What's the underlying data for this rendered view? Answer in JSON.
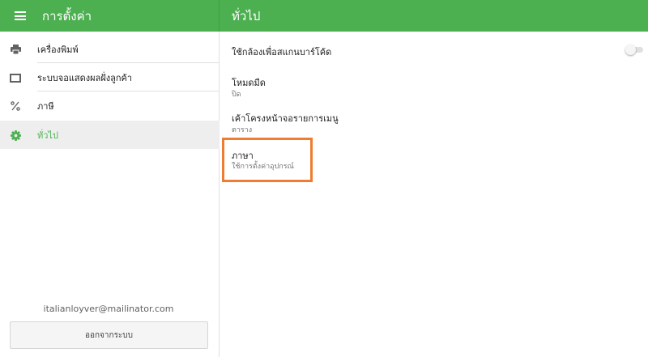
{
  "header": {
    "title": "การตั้งค่า",
    "section_title": "ทั่วไป"
  },
  "sidebar": {
    "items": [
      {
        "label": "เครื่องพิมพ์",
        "icon": "printer-icon"
      },
      {
        "label": "ระบบจอแสดงผลฝั่งลูกค้า",
        "icon": "display-icon"
      },
      {
        "label": "ภาษี",
        "icon": "percent-icon"
      },
      {
        "label": "ทั่วไป",
        "icon": "gear-icon",
        "active": true
      }
    ],
    "email": "italianloyver@mailinator.com",
    "logout_label": "ออกจากระบบ"
  },
  "settings": {
    "camera_scan": {
      "title": "ใช้กล้องเพื่อสแกนบาร์โค้ด",
      "enabled": false
    },
    "dark_mode": {
      "title": "โหมดมืด",
      "value": "ปิด"
    },
    "menu_layout": {
      "title": "เค้าโครงหน้าจอรายการเมนู",
      "value": "ตาราง"
    },
    "language": {
      "title": "ภาษา",
      "value": "ใช้การตั้งค่าอุปกรณ์"
    }
  },
  "colors": {
    "primary": "#4caf50",
    "highlight": "#ed7d31"
  }
}
